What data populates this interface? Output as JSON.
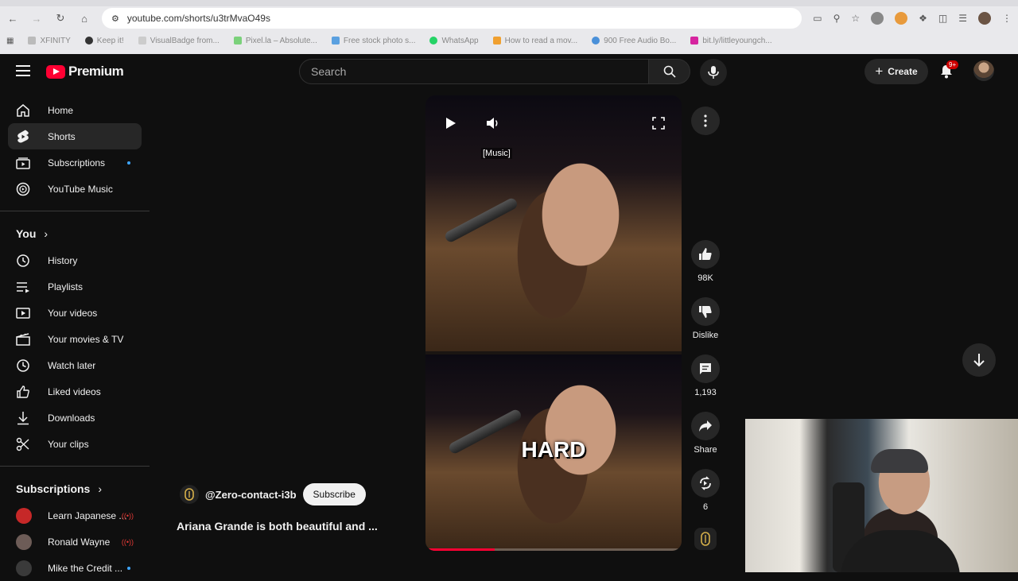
{
  "browser": {
    "url": "youtube.com/shorts/u3trMvaO49s",
    "bookmarks": [
      "XFINITY",
      "Keep it!",
      "VisualBadge from...",
      "Pixel.la – Absolute...",
      "Free stock photo s...",
      "WhatsApp",
      "How to read a mov...",
      "900 Free Audio Bo...",
      "bit.ly/littleyoungch..."
    ]
  },
  "header": {
    "logo_text": "Premium",
    "search_placeholder": "Search",
    "create_label": "Create",
    "notification_badge": "9+"
  },
  "sidebar": {
    "main": [
      {
        "label": "Home",
        "icon": "home-icon"
      },
      {
        "label": "Shorts",
        "icon": "shorts-icon",
        "active": true
      },
      {
        "label": "Subscriptions",
        "icon": "subscriptions-icon",
        "dot": true
      },
      {
        "label": "YouTube Music",
        "icon": "youtube-music-icon"
      }
    ],
    "you_heading": "You",
    "you": [
      {
        "label": "History",
        "icon": "history-icon"
      },
      {
        "label": "Playlists",
        "icon": "playlists-icon"
      },
      {
        "label": "Your videos",
        "icon": "your-videos-icon"
      },
      {
        "label": "Your movies & TV",
        "icon": "movies-icon"
      },
      {
        "label": "Watch later",
        "icon": "clock-icon"
      },
      {
        "label": "Liked videos",
        "icon": "thumbs-up-icon"
      },
      {
        "label": "Downloads",
        "icon": "download-icon"
      },
      {
        "label": "Your clips",
        "icon": "scissors-icon"
      }
    ],
    "subscriptions_heading": "Subscriptions",
    "subscriptions": [
      {
        "label": "Learn Japanese ...",
        "color": "#c62828",
        "live": true
      },
      {
        "label": "Ronald Wayne",
        "color": "#6d5c57",
        "live": true
      },
      {
        "label": "Mike the Credit ...",
        "color": "#3a3a3a",
        "dot": true
      }
    ]
  },
  "video": {
    "caption": "[Music]",
    "overlay_text": "HARD",
    "progress": 0.27
  },
  "channel": {
    "handle": "@Zero-contact-i3b",
    "subscribe_label": "Subscribe"
  },
  "video_title": "Ariana Grande is both beautiful and ...",
  "actions": {
    "likes": "98K",
    "dislike_label": "Dislike",
    "comments": "1,193",
    "share_label": "Share",
    "remix_count": "6"
  },
  "colors": {
    "brand_red": "#ff0033",
    "background": "#0f0f0f",
    "notification_dot": "#3ea6ff"
  }
}
